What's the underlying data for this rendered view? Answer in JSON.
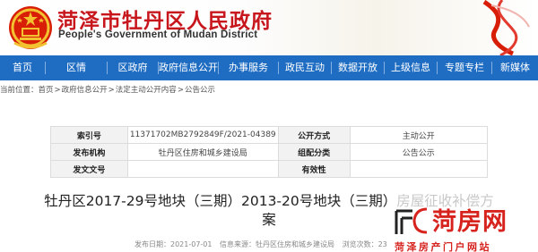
{
  "header": {
    "title": "菏泽市牡丹区人民政府",
    "subtitle": "People's Government of Mudan District"
  },
  "nav": {
    "items": [
      {
        "label": "首页"
      },
      {
        "label": "区情"
      },
      {
        "label": "区政府"
      },
      {
        "label": "政府信息公开"
      },
      {
        "label": "办事服务"
      },
      {
        "label": "政民互动"
      },
      {
        "label": "数据开放"
      },
      {
        "label": "上级信息"
      },
      {
        "label": "专题专栏"
      },
      {
        "label": "新媒体"
      }
    ],
    "bg_color": "#1f6dc3"
  },
  "breadcrumb": {
    "prefix": "当前位置：",
    "items": [
      "首页",
      "政府信息公开",
      "法定主动公开内容",
      "公告公示"
    ],
    "separator": ">"
  },
  "info_table": {
    "rows": [
      {
        "l1": "索引号",
        "v1": "11371702MB2792849F/2021-04389",
        "l2": "公开方式",
        "v2": "主动公开"
      },
      {
        "l1": "发布机构",
        "v1": "牡丹区住房和城乡建设局",
        "l2": "组配分类",
        "v2": "公告公示"
      },
      {
        "l1": "发文文号",
        "v1": "",
        "l2": "有效性",
        "v2": ""
      }
    ]
  },
  "article": {
    "title_line1": "牡丹区2017-29号地块（三期）2013-20号地块（三期）",
    "title_line1_faded": "房屋征收补偿方",
    "title_line2": "案"
  },
  "meta": {
    "date": "发布日期：2021-07-01",
    "source": "信息来源：牡丹区住房和城乡建设局",
    "views": "浏览次数：23"
  },
  "watermark": {
    "name": "菏房网",
    "sub": "菏泽房产门户网站",
    "color": "#d6231e"
  },
  "colors": {
    "brand_red": "#c8161d",
    "nav_blue": "#1f6dc3"
  }
}
